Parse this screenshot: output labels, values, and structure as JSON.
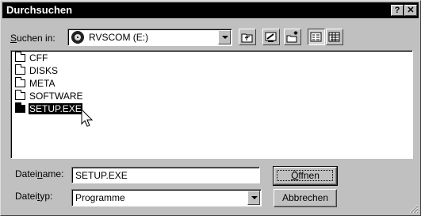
{
  "window": {
    "title": "Durchsuchen",
    "help_label": "?",
    "close_label": "✕"
  },
  "lookin": {
    "label_accel": "S",
    "label_rest": "uchen in:",
    "value": "RVSCOM (E:)",
    "icon": "cd-drive-icon"
  },
  "toolbar": {
    "up_icon": "up-folder-icon",
    "desktop_icon": "desktop-icon",
    "new_folder_icon": "new-folder-icon",
    "list_icon": "list-view-icon",
    "details_icon": "details-view-icon"
  },
  "files": [
    {
      "name": "CFF",
      "selected": false
    },
    {
      "name": "DISKS",
      "selected": false
    },
    {
      "name": "META",
      "selected": false
    },
    {
      "name": "SOFTWARE",
      "selected": false
    },
    {
      "name": "SETUP.EXE",
      "selected": true
    }
  ],
  "filename": {
    "label_pre": "Datei",
    "label_accel": "n",
    "label_post": "ame:",
    "value": "SETUP.EXE"
  },
  "filetype": {
    "label_pre": "Datei",
    "label_accel": "t",
    "label_post": "yp:",
    "value": "Programme"
  },
  "buttons": {
    "open_accel": "Ö",
    "open_rest": "ffnen",
    "cancel": "Abbrechen"
  }
}
